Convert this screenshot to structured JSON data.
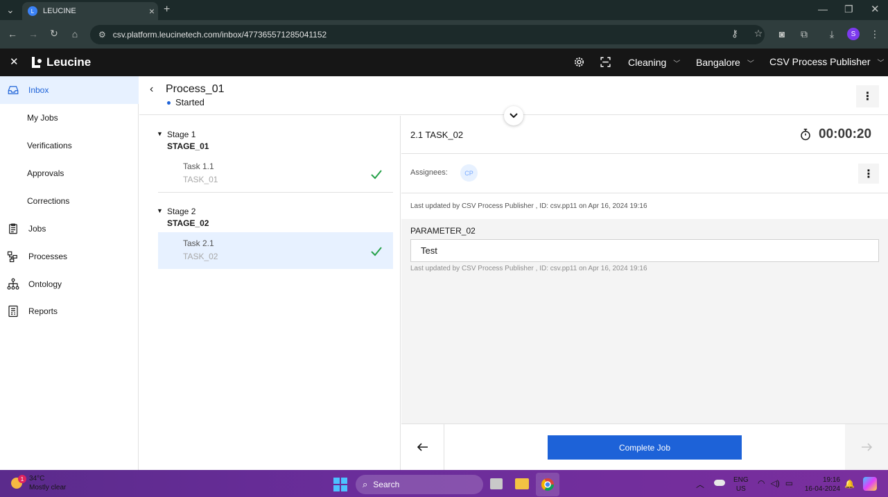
{
  "browser": {
    "tab_title": "LEUCINE",
    "url": "csv.platform.leucinetech.com/inbox/477365571285041152",
    "profile_initial": "S"
  },
  "app": {
    "logo_text": "Leucine",
    "facility_select": "Cleaning",
    "location_select": "Bangalore",
    "user_select": "CSV Process Publisher"
  },
  "sidebar": {
    "items": [
      {
        "label": "Inbox",
        "icon": "inbox-icon"
      },
      {
        "label": "My Jobs"
      },
      {
        "label": "Verifications"
      },
      {
        "label": "Approvals"
      },
      {
        "label": "Corrections"
      },
      {
        "label": "Jobs",
        "icon": "clipboard-icon"
      },
      {
        "label": "Processes",
        "icon": "process-icon"
      },
      {
        "label": "Ontology",
        "icon": "hierarchy-icon"
      },
      {
        "label": "Reports",
        "icon": "report-icon"
      }
    ]
  },
  "process": {
    "title": "Process_01",
    "status": "Started"
  },
  "stages": [
    {
      "label": "Stage 1",
      "name": "STAGE_01",
      "tasks": [
        {
          "label": "Task 1.1",
          "code": "TASK_01"
        }
      ]
    },
    {
      "label": "Stage 2",
      "name": "STAGE_02",
      "tasks": [
        {
          "label": "Task 2.1",
          "code": "TASK_02"
        }
      ]
    }
  ],
  "task": {
    "title": "2.1 TASK_02",
    "timer": "00:00:20",
    "assignees_label": "Assignees:",
    "assignee_initials": "CP",
    "last_updated": "Last updated by CSV Process Publisher , ID: csv.pp11 on Apr 16, 2024 19:16",
    "parameter_label": "PARAMETER_02",
    "parameter_value": "Test",
    "parameter_updated": "Last updated by CSV Process Publisher , ID: csv.pp11 on Apr 16, 2024 19:16"
  },
  "footer": {
    "complete_label": "Complete Job"
  },
  "taskbar": {
    "temperature": "34°C",
    "weather": "Mostly clear",
    "weather_badge": "1",
    "search_label": "Search",
    "lang_top": "ENG",
    "lang_bottom": "US",
    "time": "19:16",
    "date": "16-04-2024"
  },
  "colors": {
    "accent": "#1d62d8",
    "header_bg": "#161616",
    "success": "#24a148"
  }
}
